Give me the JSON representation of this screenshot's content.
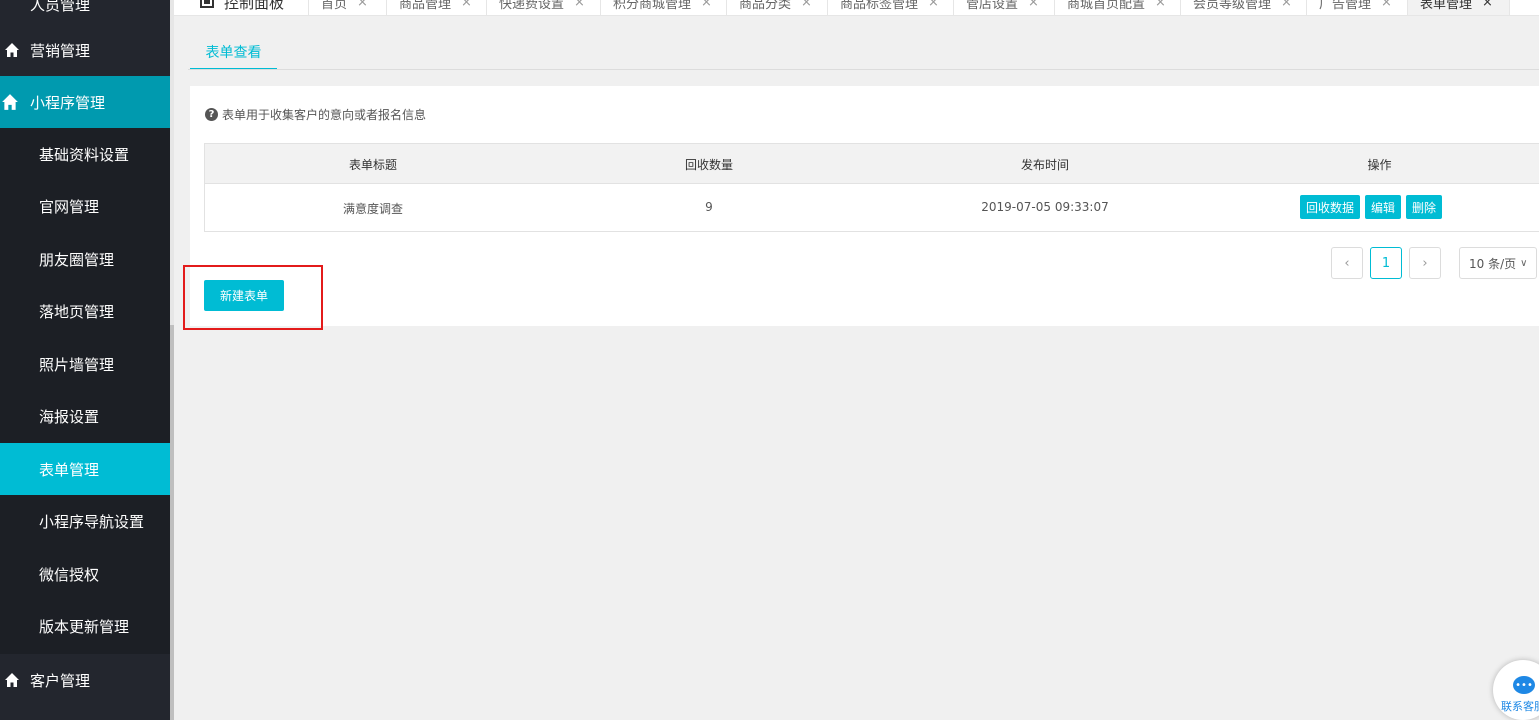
{
  "sidebar": {
    "top_partial_label": "人员管理",
    "marketing_label": "营销管理",
    "miniprogram_label": "小程序管理",
    "submenu": [
      {
        "label": "基础资料设置"
      },
      {
        "label": "官网管理"
      },
      {
        "label": "朋友圈管理"
      },
      {
        "label": "落地页管理"
      },
      {
        "label": "照片墙管理"
      },
      {
        "label": "海报设置"
      },
      {
        "label": "表单管理"
      },
      {
        "label": "小程序导航设置"
      },
      {
        "label": "微信授权"
      },
      {
        "label": "版本更新管理"
      }
    ],
    "active_submenu": "表单管理",
    "customer_label": "客户管理"
  },
  "tabs": [
    {
      "label": "控制面板"
    },
    {
      "label": "首页"
    },
    {
      "label": "商品管理"
    },
    {
      "label": "快递费设置"
    },
    {
      "label": "积分商城管理"
    },
    {
      "label": "商品分类"
    },
    {
      "label": "商品标签管理"
    },
    {
      "label": "管店设置"
    },
    {
      "label": "商城首页配置"
    },
    {
      "label": "会员等级管理"
    },
    {
      "label": "广告管理"
    },
    {
      "label": "表单管理"
    }
  ],
  "page_tab": "表单查看",
  "tip": "表单用于收集客户的意向或者报名信息",
  "table": {
    "headers": [
      "表单标题",
      "回收数量",
      "发布时间",
      "操作"
    ],
    "rows": [
      {
        "title": "满意度调查",
        "count": "9",
        "published": "2019-07-05 09:33:07"
      }
    ],
    "actions": {
      "collect": "回收数据",
      "edit": "编辑",
      "delete": "删除"
    }
  },
  "pagination": {
    "prev": "‹",
    "current_page": "1",
    "next": "›",
    "page_size": "10 条/页"
  },
  "new_form_button": "新建表单",
  "customer_service": "联系客服",
  "colors": {
    "accent": "#00bcd4",
    "sidebar_bg": "#23262e",
    "highlight": "#e31b1b"
  }
}
